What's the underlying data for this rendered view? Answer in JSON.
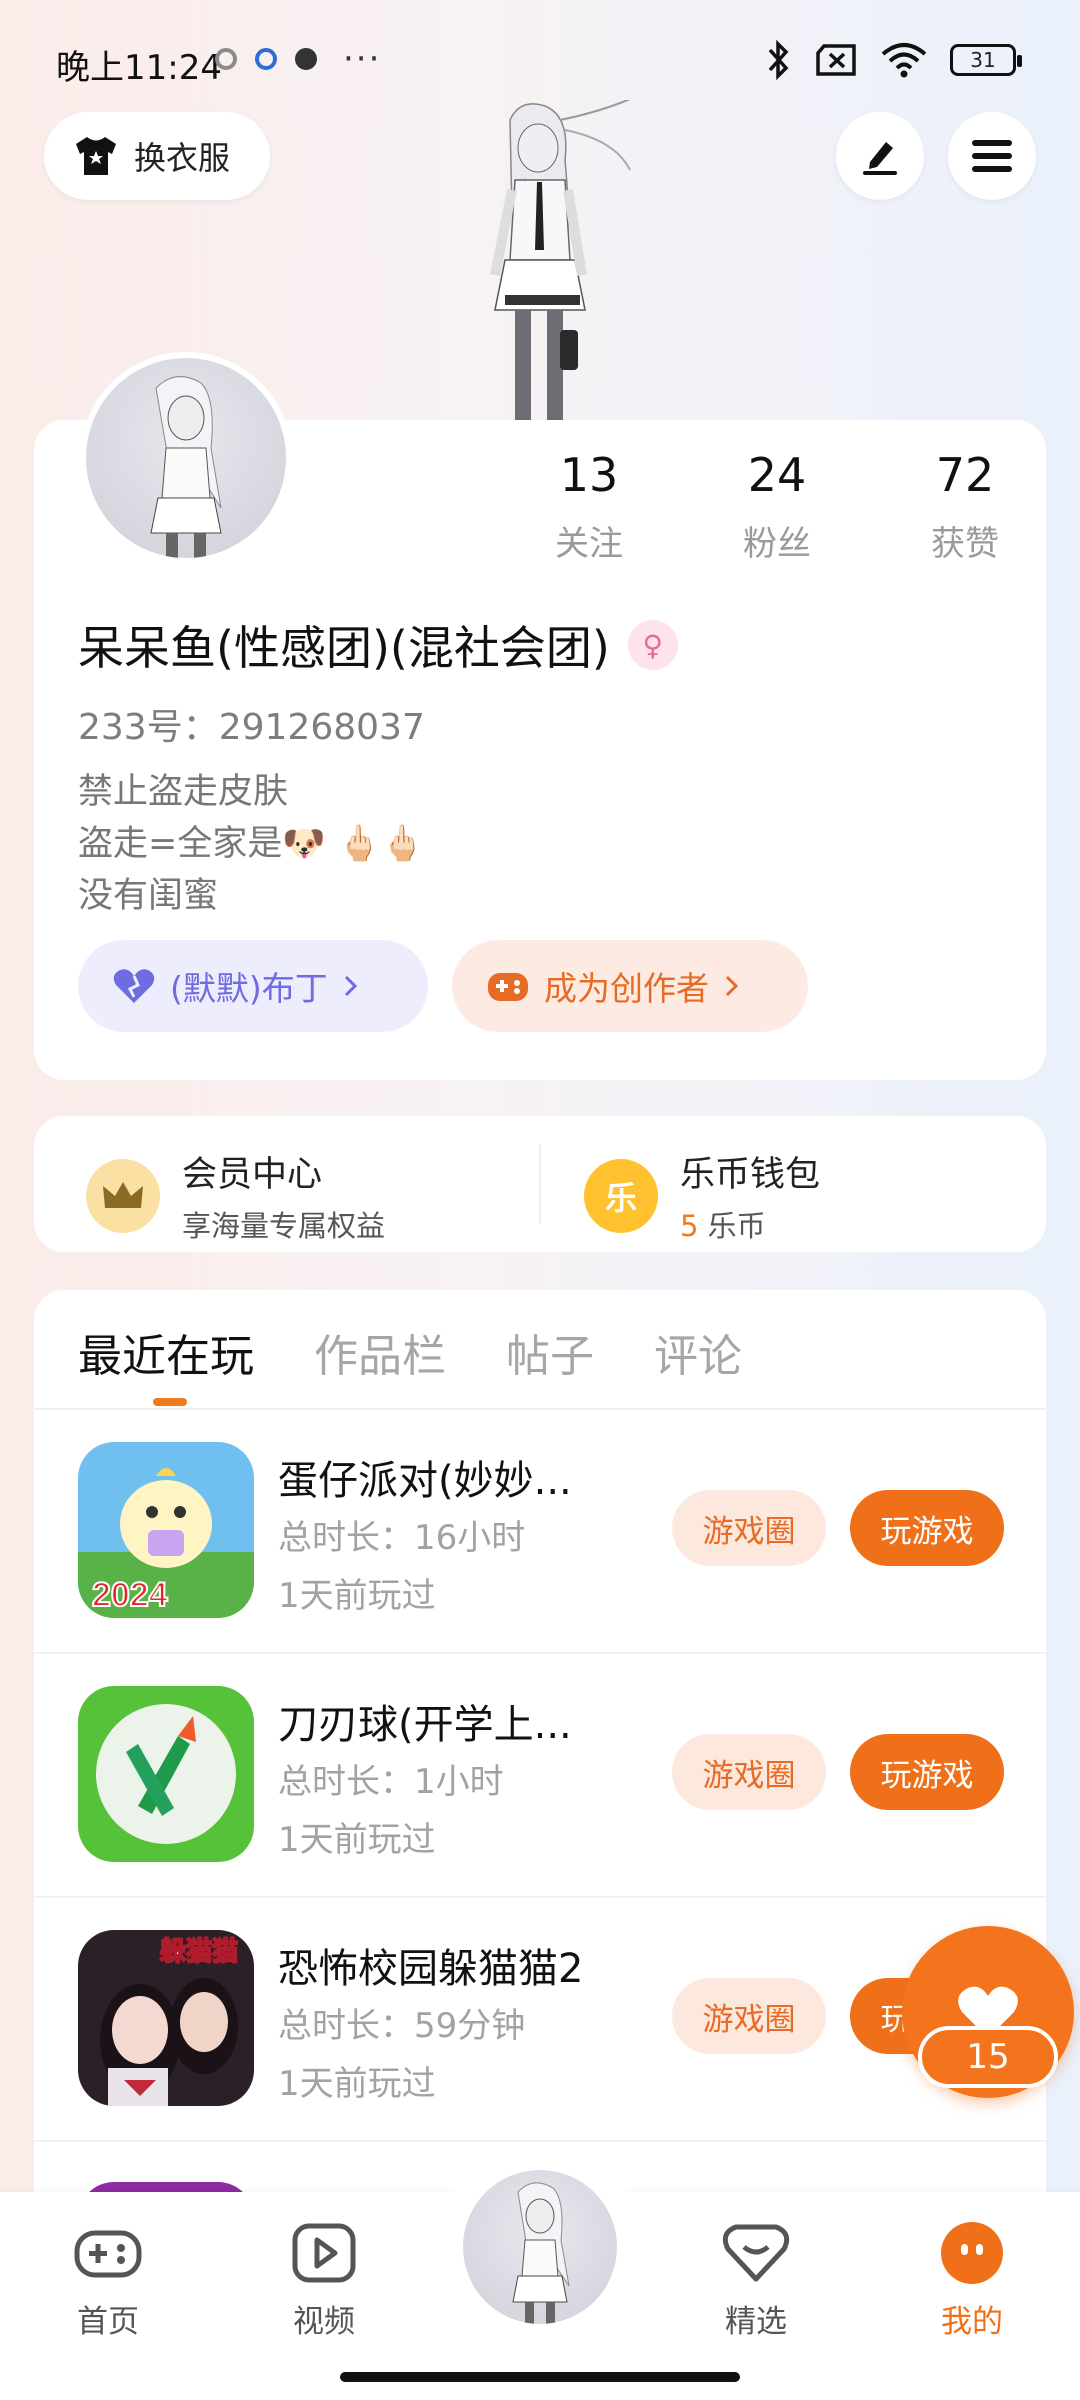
{
  "status_bar": {
    "time": "晚上11:24",
    "battery": "31"
  },
  "header": {
    "dress_button_label": "换衣服"
  },
  "profile": {
    "stats": [
      {
        "value": "13",
        "label": "关注"
      },
      {
        "value": "24",
        "label": "粉丝"
      },
      {
        "value": "72",
        "label": "获赞"
      }
    ],
    "nickname": "呆呆鱼(性感团)(混社会团)",
    "gender_symbol": "♀",
    "user_id": "233号：291268037",
    "bio": [
      "禁止盗走皮肤",
      "盗走=全家是🐶 🖕🏻🖕🏻",
      "没有闺蜜"
    ],
    "pudding_label": "(默默)布丁",
    "creator_label": "成为创作者"
  },
  "vip": {
    "member_title": "会员中心",
    "member_sub": "享海量专属权益",
    "wallet_title": "乐币钱包",
    "wallet_icon_text": "乐",
    "coin_count": "5",
    "coin_unit": " 乐币"
  },
  "tabs": [
    "最近在玩",
    "作品栏",
    "帖子",
    "评论"
  ],
  "games": [
    {
      "name": "蛋仔派对(妙妙...",
      "duration": "总时长：16小时",
      "last_played": "1天前玩过",
      "circle_label": "游戏圈",
      "play_label": "玩游戏"
    },
    {
      "name": "刀刃球(开学上...",
      "duration": "总时长：1小时",
      "last_played": "1天前玩过",
      "circle_label": "游戏圈",
      "play_label": "玩游戏"
    },
    {
      "name": "恐怖校园躲猫猫2",
      "duration": "总时长：59分钟",
      "last_played": "1天前玩过",
      "circle_label": "游戏圈",
      "play_label": "玩游戏"
    }
  ],
  "game_icon_labels": {
    "egg_party_year": "2024",
    "hide_seek_title": "躲猫猫"
  },
  "like": {
    "count": "15"
  },
  "nav": {
    "home": "首页",
    "video": "视频",
    "picks": "精选",
    "mine": "我的"
  },
  "colors": {
    "accent": "#f07019",
    "purple": "#6f6be0"
  }
}
